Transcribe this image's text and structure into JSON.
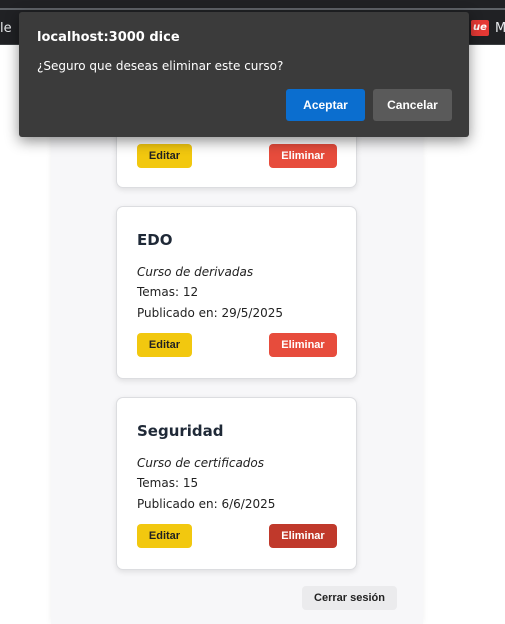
{
  "browser": {
    "bookmark_left": "le",
    "bookmark_right_icon": "ue",
    "bookmark_right_label": "M"
  },
  "dialog": {
    "title": "localhost:3000 dice",
    "message": "¿Seguro que deseas eliminar este curso?",
    "accept_label": "Aceptar",
    "cancel_label": "Cancelar"
  },
  "courses": [
    {
      "edit_label": "Editar",
      "delete_label": "Eliminar"
    },
    {
      "title": "EDO",
      "description": "Curso de derivadas",
      "topics": "Temas: 12",
      "published": "Publicado en: 29/5/2025",
      "edit_label": "Editar",
      "delete_label": "Eliminar"
    },
    {
      "title": "Seguridad",
      "description": "Curso de certificados",
      "topics": "Temas: 15",
      "published": "Publicado en: 6/6/2025",
      "edit_label": "Editar",
      "delete_label": "Eliminar"
    }
  ],
  "logout_label": "Cerrar sesión",
  "colors": {
    "edit": "#f2c80f",
    "delete": "#e74c3c",
    "delete_active": "#c0392b",
    "accept": "#0b6ecf",
    "dialog_bg": "#3b3b3b"
  }
}
